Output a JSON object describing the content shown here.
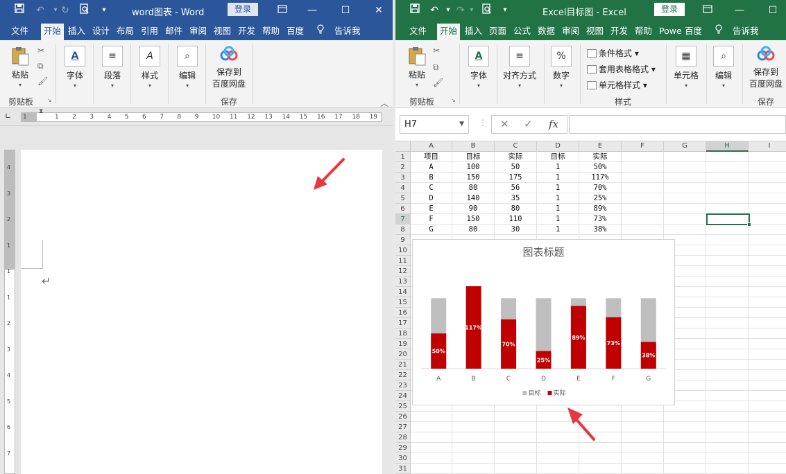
{
  "word": {
    "title": "word图表 - Word",
    "login": "登录",
    "tabs": [
      "文件",
      "开始",
      "插入",
      "设计",
      "布局",
      "引用",
      "邮件",
      "审阅",
      "视图",
      "开发",
      "帮助",
      "百度"
    ],
    "tell_me": "告诉我",
    "ribbon": {
      "paste": "粘贴",
      "clipboard_group": "剪贴板",
      "font": "字体",
      "paragraph": "段落",
      "styles": "样式",
      "editing": "编辑",
      "save_baidu_line1": "保存到",
      "save_baidu_line2": "百度网盘",
      "save_group": "保存"
    },
    "ruler_numbers": [
      "1",
      "1",
      "2",
      "3",
      "4",
      "5",
      "6",
      "7",
      "8",
      "9",
      "10",
      "11",
      "12",
      "13",
      "14",
      "15",
      "16",
      "17",
      "18",
      "19"
    ],
    "vruler_numbers": [
      "4",
      "3",
      "2",
      "1",
      "1",
      "1",
      "2",
      "3",
      "4",
      "5",
      "6",
      "7"
    ],
    "paragraph_mark": "↵"
  },
  "excel": {
    "title": "Excel目标图 - Excel",
    "login": "登录",
    "tabs": [
      "文件",
      "开始",
      "插入",
      "页面",
      "公式",
      "数据",
      "审阅",
      "视图",
      "开发",
      "帮助",
      "Powe",
      "百度"
    ],
    "tell_me": "告诉我",
    "ribbon": {
      "paste": "粘贴",
      "clipboard_group": "剪贴板",
      "font": "字体",
      "alignment": "对齐方式",
      "number": "数字",
      "cond_format": "条件格式",
      "table_format": "套用表格格式",
      "cell_styles": "单元格样式",
      "styles_group": "样式",
      "cells": "单元格",
      "editing": "编辑",
      "save_baidu_line1": "保存到",
      "save_baidu_line2": "百度网盘",
      "save_group": "保存"
    },
    "name_box": "H7",
    "columns": [
      "A",
      "B",
      "C",
      "D",
      "E",
      "F",
      "G",
      "H",
      "I"
    ],
    "rows": [
      "1",
      "2",
      "3",
      "4",
      "5",
      "6",
      "7",
      "8",
      "9",
      "10",
      "11",
      "12",
      "13",
      "14",
      "15",
      "16",
      "17",
      "18",
      "19",
      "20",
      "21",
      "22",
      "23",
      "24",
      "25",
      "26",
      "27",
      "28",
      "29",
      "30",
      "31"
    ],
    "table": [
      [
        "项目",
        "目标",
        "实际",
        "目标",
        "实际"
      ],
      [
        "A",
        "100",
        "50",
        "1",
        "50%"
      ],
      [
        "B",
        "150",
        "175",
        "1",
        "117%"
      ],
      [
        "C",
        "80",
        "56",
        "1",
        "70%"
      ],
      [
        "D",
        "140",
        "35",
        "1",
        "25%"
      ],
      [
        "E",
        "90",
        "80",
        "1",
        "89%"
      ],
      [
        "F",
        "150",
        "110",
        "1",
        "73%"
      ],
      [
        "G",
        "80",
        "30",
        "1",
        "38%"
      ]
    ]
  },
  "chart_data": {
    "type": "bar",
    "title": "图表标题",
    "categories": [
      "A",
      "B",
      "C",
      "D",
      "E",
      "F",
      "G"
    ],
    "series": [
      {
        "name": "目标",
        "values": [
          1,
          1,
          1,
          1,
          1,
          1,
          1
        ],
        "color": "#bfbfbf"
      },
      {
        "name": "实际",
        "values": [
          0.5,
          1.17,
          0.7,
          0.25,
          0.89,
          0.73,
          0.38
        ],
        "color": "#c00000"
      }
    ],
    "data_labels": [
      "50%",
      "117%",
      "70%",
      "25%",
      "89%",
      "73%",
      "38%"
    ],
    "ylim": [
      0,
      1.2
    ],
    "grid": false,
    "legend": "bottom"
  },
  "colors": {
    "word_blue": "#2b579a",
    "excel_green": "#217346",
    "arrow_red": "#e8383d"
  }
}
